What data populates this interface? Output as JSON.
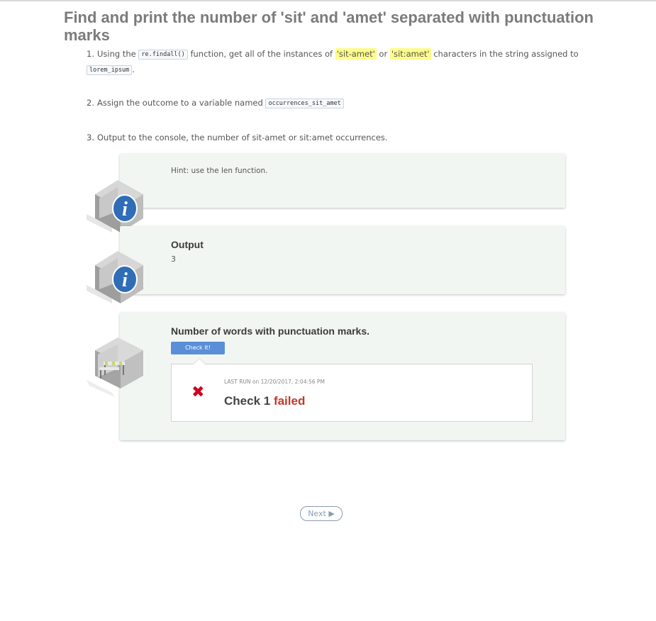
{
  "title": "Find and print the number of 'sit' and 'amet' separated with punctuation marks",
  "steps": [
    {
      "num": "1.",
      "pre": "Using the ",
      "code1": "re.findall()",
      "mid": " function, get all of the instances of ",
      "hl1": "'sit-amet'",
      "or": " or ",
      "hl2": "'sit:amet'",
      "post": " characters in the string assigned to ",
      "code2": "lorem_ipsum",
      "end": "."
    },
    {
      "num": "2.",
      "pre": "Assign the outcome to a variable named ",
      "code1": "occurrences_sit_amet"
    },
    {
      "num": "3.",
      "text": "Output to the console, the number of sit-amet or sit:amet occurrences."
    }
  ],
  "hint_card": {
    "text": "Hint: use the len function.",
    "icon": "info-cube-icon"
  },
  "output_card": {
    "title": "Output",
    "value": "3",
    "icon": "info-cube-icon"
  },
  "check_card": {
    "title": "Number of words with punctuation marks.",
    "button": "Check It!",
    "icon": "hurdle-cube-icon",
    "result": {
      "last_run": "LAST RUN on 12/20/2017, 2:04:56 PM",
      "status_icon": "x-icon",
      "check_label": "Check 1",
      "status": "failed"
    }
  },
  "next_button": "Next ▶",
  "colors": {
    "accent": "#5a8fd8",
    "fail": "#c0392b",
    "card_bg": "#f2f6f3",
    "highlight": "#fffc8a"
  }
}
